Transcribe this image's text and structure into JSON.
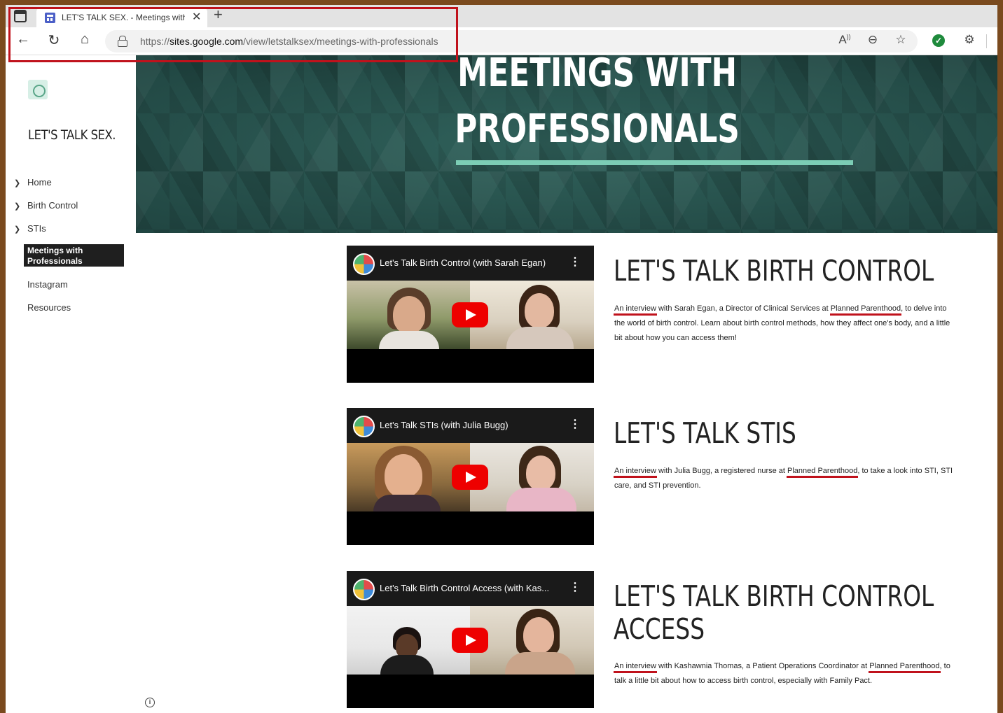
{
  "browser": {
    "tab_title": "LET'S TALK SEX. - Meetings with Professionals",
    "new_tab": "+",
    "url_prefix": "https://",
    "url_host": "sites.google.com",
    "url_path": "/view/letstalksex/meetings-with-professionals"
  },
  "sidebar": {
    "site_title": "LET'S TALK SEX.",
    "nav": [
      {
        "label": "Home"
      },
      {
        "label": "Birth Control"
      },
      {
        "label": "STIs"
      }
    ],
    "active_label": "Meetings with Professionals",
    "links": [
      {
        "label": "Instagram"
      },
      {
        "label": "Resources"
      }
    ]
  },
  "hero": {
    "title_line1": "MEETINGS WITH",
    "title_line2": "PROFESSIONALS"
  },
  "sections": [
    {
      "video_title": "Let's Talk Birth Control (with Sarah Egan)",
      "heading": "LET'S TALK BIRTH CONTROL",
      "desc_link1": "An interview",
      "desc_text1": " with Sarah Egan, a Director of Clinical Services at ",
      "desc_link2": "Planned Parenthood",
      "desc_text2": ", to delve into the world of birth control. Learn about birth control methods, how they affect one's body, and a little bit about how you can access them!"
    },
    {
      "video_title": "Let's Talk STIs (with Julia Bugg)",
      "heading": "LET'S TALK STIS",
      "desc_link1": "An interview",
      "desc_text1": " with Julia Bugg, a registered nurse at ",
      "desc_link2": "Planned Parenthood",
      "desc_text2": ", to take a look into STI, STI care, and STI prevention."
    },
    {
      "video_title": "Let's Talk Birth Control Access (with Kas...",
      "heading_line1": "LET'S TALK BIRTH CONTROL",
      "heading_line2": "ACCESS",
      "desc_link1": "An interview",
      "desc_text1": " with Kashawnia Thomas, a Patient Operations Coordinator at ",
      "desc_link2": "Planned Parenthood",
      "desc_text2": ", to talk a little bit about how to access birth control, especially with Family Pact."
    }
  ],
  "colors": {
    "frame": "#7a4a1e",
    "annotation": "#c0121c",
    "hero_bg": "#2c5a55",
    "hero_rule": "#7ccdb5",
    "youtube_red": "#ee0000"
  }
}
